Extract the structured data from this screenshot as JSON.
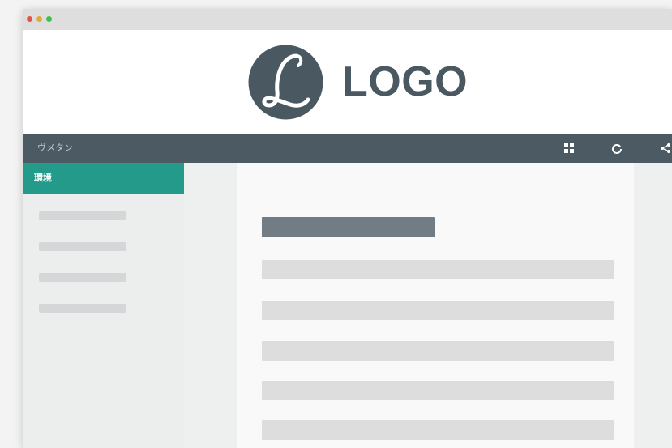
{
  "header": {
    "logo_text": "LOGO",
    "logo_emblem_letter": "L",
    "logo_color": "#4a5861"
  },
  "navbar": {
    "title": "ヴメタン",
    "icons": [
      "grid-icon",
      "refresh-icon",
      "share-icon"
    ],
    "background": "#4c5a63"
  },
  "sidebar": {
    "active_item": {
      "label": "環境",
      "color": "#249a8a"
    },
    "placeholder_items": 4
  },
  "main": {
    "placeholder_heading": true,
    "placeholder_lines": 5
  }
}
